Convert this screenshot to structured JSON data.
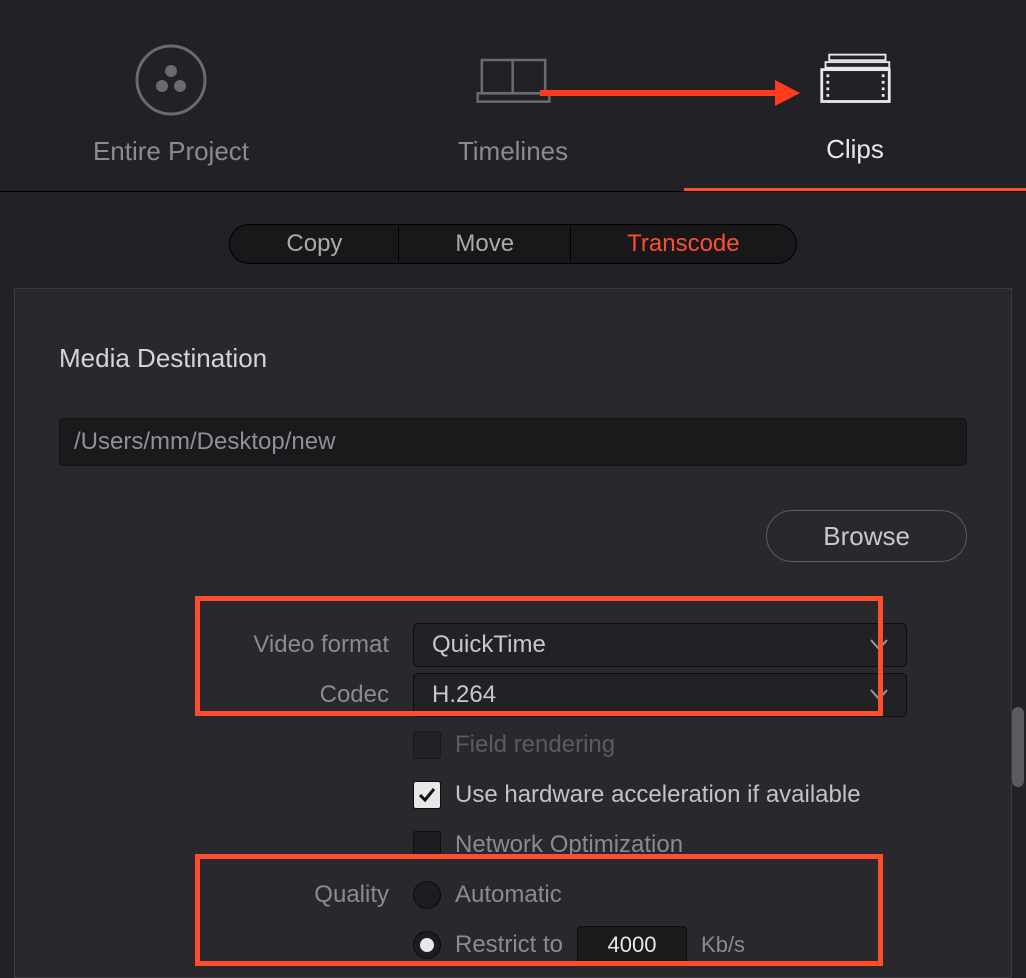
{
  "tabs": {
    "entire_project": "Entire Project",
    "timelines": "Timelines",
    "clips": "Clips"
  },
  "mode": {
    "copy": "Copy",
    "move": "Move",
    "transcode": "Transcode"
  },
  "section": {
    "media_destination": "Media Destination",
    "path": "/Users/mm/Desktop/new",
    "browse": "Browse"
  },
  "fields": {
    "video_format_label": "Video format",
    "video_format_value": "QuickTime",
    "codec_label": "Codec",
    "codec_value": "H.264",
    "field_rendering": "Field rendering",
    "hw_accel": "Use hardware acceleration if available",
    "network_opt": "Network Optimization",
    "quality_label": "Quality",
    "quality_auto": "Automatic",
    "quality_restrict": "Restrict to",
    "restrict_value": "4000",
    "restrict_unit": "Kb/s"
  }
}
